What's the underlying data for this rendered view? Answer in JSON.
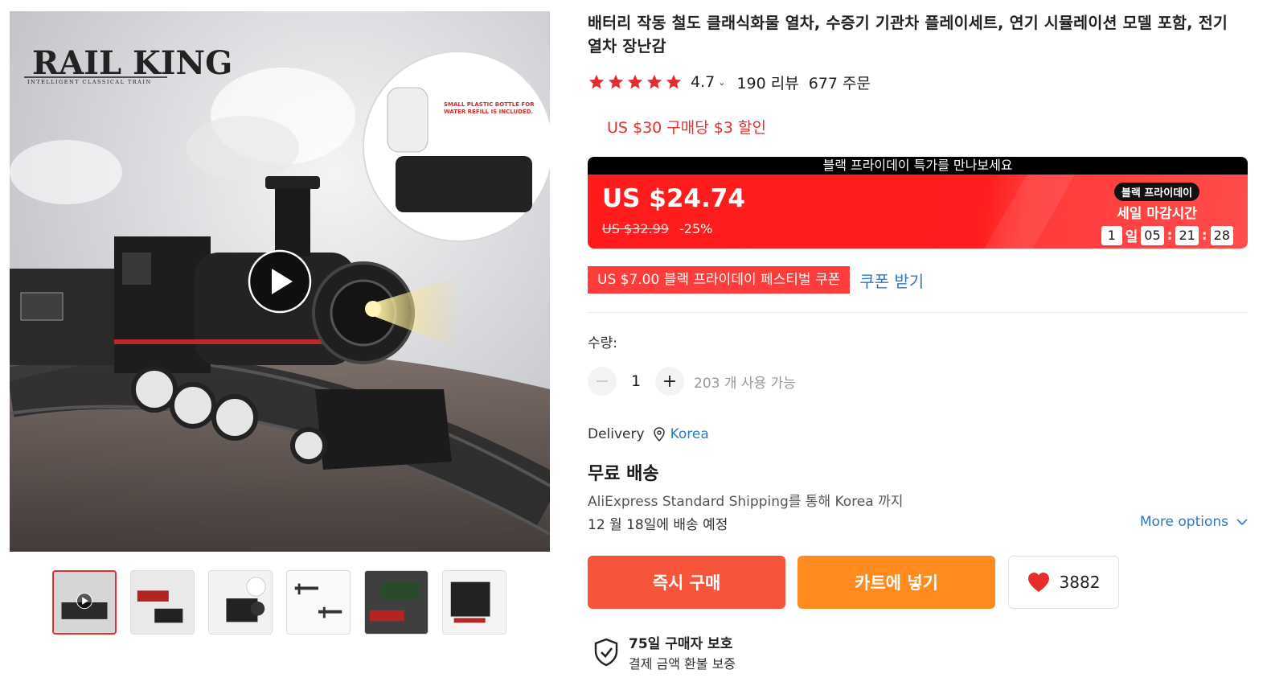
{
  "gallery": {
    "brand_logo": "RAIL KING",
    "brand_tagline": "INTELLIGENT CLASSICAL TRAIN",
    "callout_text": "SMALL PLASTIC BOTTLE FOR WATER REFILL IS INCLUDED.",
    "thumbnail_count": 6,
    "active_thumbnail": 1
  },
  "product": {
    "title": "배터리 작동 철도 클래식화물 열차, 수증기 기관차 플레이세트, 연기 시뮬레이션 모델 포함, 전기 열차 장난감",
    "rating": "4.7",
    "reviews": "190 리뷰",
    "orders": "677 주문"
  },
  "promo": {
    "threshold": "US $30 구매당 $3 할인"
  },
  "black_friday": {
    "banner_title": "블랙 프라이데이 특가를 만나보세요",
    "price": "US $24.74",
    "original_price": "US $32.99",
    "discount": "-25%",
    "tag": "블랙 프라이데이",
    "deadline_label": "세일 마감시간",
    "countdown": {
      "days": "1",
      "days_unit": "일",
      "hours": "05",
      "minutes": "21",
      "seconds": "28",
      "sep": ":"
    }
  },
  "coupon": {
    "label": "US $7.00 블랙 프라이데이 페스티벌 쿠폰",
    "action": "쿠폰 받기"
  },
  "quantity": {
    "label": "수량:",
    "minus": "−",
    "value": "1",
    "plus": "+",
    "available": "203 개 사용 가능"
  },
  "delivery": {
    "label": "Delivery",
    "country": "Korea",
    "shipping_title": "무료 배송",
    "shipping_desc": "AliExpress Standard Shipping를 통해 Korea 까지",
    "date": "12 월 18일에 배송 예정",
    "more_options": "More options"
  },
  "actions": {
    "buy_now": "즉시 구매",
    "add_to_cart": "카트에 넣기",
    "wishlist_count": "3882"
  },
  "protection": {
    "title": "75일 구매자 보호",
    "subtitle": "결제 금액 환불 보증"
  },
  "colors": {
    "accent_red": "#e62e2e",
    "link_blue": "#2e7ac7",
    "buy_orange": "#f7553a",
    "cart_orange": "#ff8b1f",
    "star_red": "#e62e2e"
  }
}
